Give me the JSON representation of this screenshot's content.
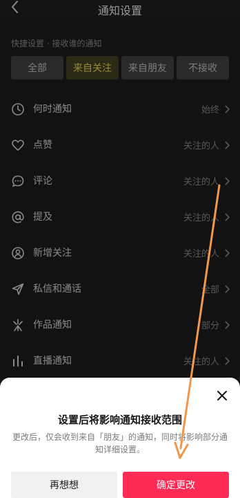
{
  "header": {
    "title": "通知设置"
  },
  "section_label": "快捷设置 · 接收谁的通知",
  "chips": [
    {
      "label": "全部"
    },
    {
      "label": "来自关注",
      "active": true
    },
    {
      "label": "来自朋友"
    },
    {
      "label": "不接收"
    }
  ],
  "rows": [
    {
      "icon": "clock-icon",
      "label": "何时通知",
      "value": "始终"
    },
    {
      "icon": "heart-icon",
      "label": "点赞",
      "value": "关注的人"
    },
    {
      "icon": "comment-icon",
      "label": "评论",
      "value": "关注的人"
    },
    {
      "icon": "at-icon",
      "label": "提及",
      "value": "关注的人"
    },
    {
      "icon": "user-add-icon",
      "label": "新增关注",
      "value": "关注的人"
    },
    {
      "icon": "send-icon",
      "label": "私信和通话",
      "value": "全部"
    },
    {
      "icon": "sparkle-icon",
      "label": "作品通知",
      "value": "部分"
    },
    {
      "icon": "live-bars-icon",
      "label": "直播通知",
      "value": "关注的人"
    }
  ],
  "sheet": {
    "title": "设置后将影响通知接收范围",
    "description": "更改后，仅会收到来自「朋友」的通知，同时将影响部分通知详细设置。",
    "cancel_label": "再想想",
    "confirm_label": "确定更改"
  },
  "colors": {
    "accent": "#fe2c55",
    "active_chip_text": "#9c8b35",
    "annotation_arrow": "#f2984a"
  }
}
